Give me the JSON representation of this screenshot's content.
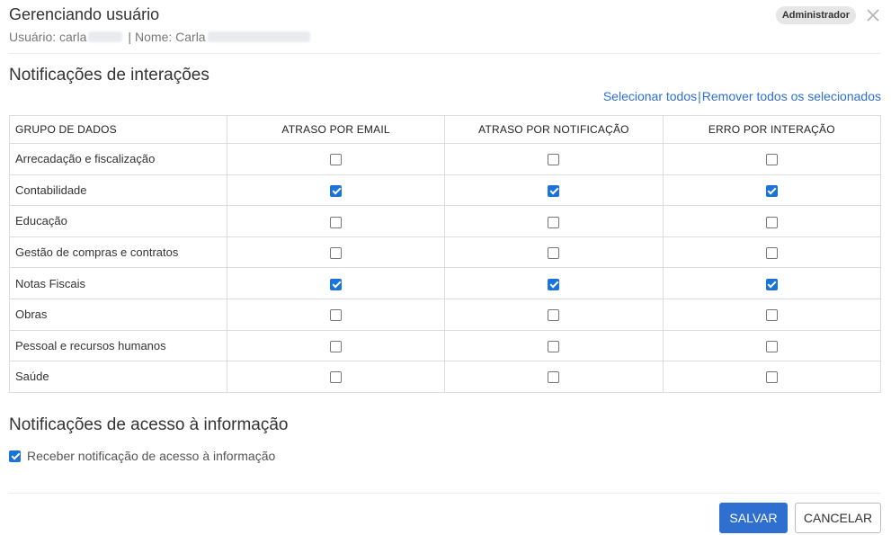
{
  "header": {
    "title": "Gerenciando usuário",
    "user_label": "Usuário: carla",
    "separator": "|",
    "name_label": "Nome: Carla",
    "role_badge": "Administrador",
    "close_icon": "close-icon"
  },
  "interactions": {
    "title": "Notificações de interações",
    "select_all": "Selecionar todos",
    "divider": "|",
    "remove_all": "Remover todos os selecionados",
    "columns": [
      "GRUPO DE DADOS",
      "ATRASO POR EMAIL",
      "ATRASO POR NOTIFICAÇÃO",
      "ERRO POR INTERAÇÃO"
    ],
    "rows": [
      {
        "name": "Arrecadação e fiscalização",
        "email": false,
        "notification": false,
        "error": false
      },
      {
        "name": "Contabilidade",
        "email": true,
        "notification": true,
        "error": true
      },
      {
        "name": "Educação",
        "email": false,
        "notification": false,
        "error": false
      },
      {
        "name": "Gestão de compras e contratos",
        "email": false,
        "notification": false,
        "error": false
      },
      {
        "name": "Notas Fiscais",
        "email": true,
        "notification": true,
        "error": true
      },
      {
        "name": "Obras",
        "email": false,
        "notification": false,
        "error": false
      },
      {
        "name": "Pessoal e recursos humanos",
        "email": false,
        "notification": false,
        "error": false
      },
      {
        "name": "Saúde",
        "email": false,
        "notification": false,
        "error": false
      }
    ]
  },
  "access": {
    "title": "Notificações de acesso à informação",
    "checkbox_label": "Receber notificação de acesso à informação",
    "checked": true
  },
  "footer": {
    "save_label": "SALVAR",
    "cancel_label": "CANCELAR"
  },
  "colors": {
    "accent": "#2f6fd0",
    "checkbox_checked": "#1a73d9",
    "badge_bg": "#e6e6e6",
    "border": "#dddddd"
  }
}
